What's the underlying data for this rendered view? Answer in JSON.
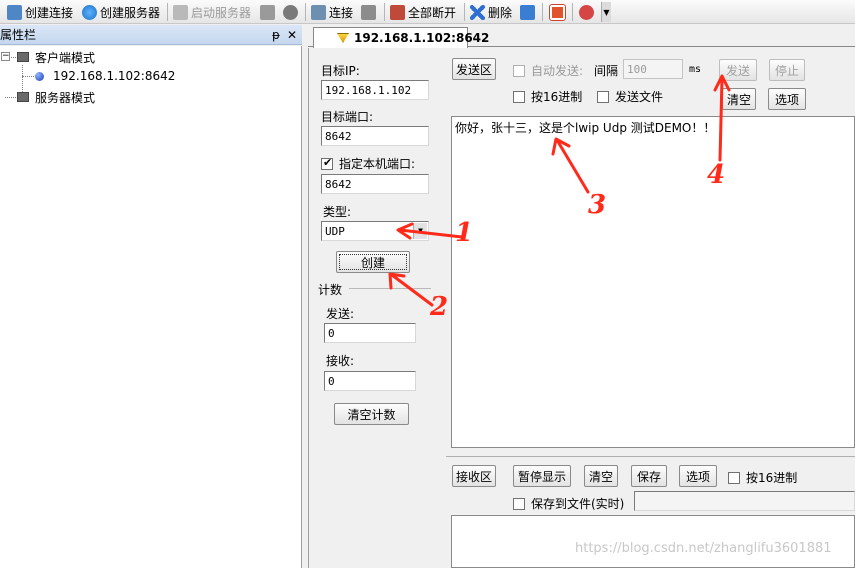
{
  "toolbar": {
    "create_connection": "创建连接",
    "create_server": "创建服务器",
    "start_server": "启动服务器",
    "connect": "连接",
    "disconnect_all": "全部断开",
    "delete": "删除",
    "icons": [
      "new-doc-icon",
      "globe-icon",
      "server-icon",
      "link-icon",
      "close-circle-icon",
      "connect-icon",
      "network-icon",
      "disconnect-icon",
      "delete-icon",
      "puzzle-icon",
      "stop-icon",
      "help-icon",
      "dropdown-icon"
    ]
  },
  "left_panel": {
    "title": "属性栏",
    "pin": "ᵽ",
    "close": "✕",
    "tree": {
      "client_mode": "客户端模式",
      "client_item": "192.168.1.102:8642",
      "server_mode": "服务器模式"
    }
  },
  "tab": {
    "label": "192.168.1.102:8642"
  },
  "settings": {
    "target_ip_label": "目标IP:",
    "target_ip": "192.168.1.102",
    "target_port_label": "目标端口:",
    "target_port": "8642",
    "local_port_label": "指定本机端口:",
    "local_port": "8642",
    "type_label": "类型:",
    "type_value": "UDP",
    "create_button": "创建"
  },
  "count": {
    "title": "计数",
    "sent_label": "发送:",
    "sent": "0",
    "recv_label": "接收:",
    "recv": "0",
    "clear_button": "清空计数"
  },
  "send": {
    "area_button": "发送区",
    "auto_send": "自动发送:",
    "interval_label": "间隔",
    "interval": "100",
    "unit": "ms",
    "send_button": "发送",
    "stop_button": "停止",
    "hex": "按16进制",
    "send_file": "发送文件",
    "clear_button": "清空",
    "options_button": "选项",
    "content": "你好，张十三，这是个lwip Udp 测试DEMO！！"
  },
  "recv": {
    "area_button": "接收区",
    "pause_button": "暂停显示",
    "clear_button": "清空",
    "save_button": "保存",
    "options_button": "选项",
    "hex": "按16进制",
    "save_file": "保存到文件(实时)"
  },
  "annotations": {
    "a1": "1",
    "a2": "2",
    "a3": "3",
    "a4": "4",
    "color": "#ff2a1a"
  },
  "watermark": "https://blog.csdn.net/zhanglifu3601881"
}
